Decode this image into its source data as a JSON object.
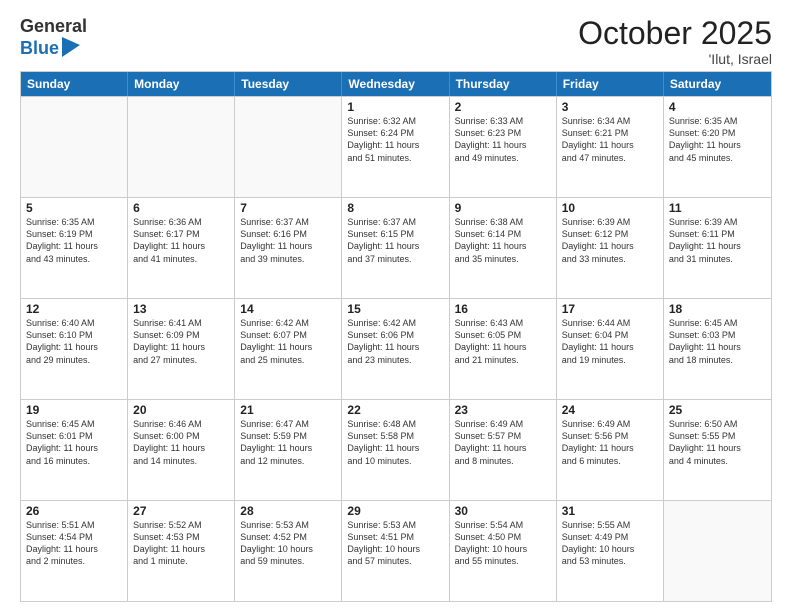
{
  "logo": {
    "general": "General",
    "blue": "Blue"
  },
  "title": "October 2025",
  "subtitle": "'Ilut, Israel",
  "days": [
    "Sunday",
    "Monday",
    "Tuesday",
    "Wednesday",
    "Thursday",
    "Friday",
    "Saturday"
  ],
  "weeks": [
    [
      {
        "day": "",
        "text": ""
      },
      {
        "day": "",
        "text": ""
      },
      {
        "day": "",
        "text": ""
      },
      {
        "day": "1",
        "text": "Sunrise: 6:32 AM\nSunset: 6:24 PM\nDaylight: 11 hours\nand 51 minutes."
      },
      {
        "day": "2",
        "text": "Sunrise: 6:33 AM\nSunset: 6:23 PM\nDaylight: 11 hours\nand 49 minutes."
      },
      {
        "day": "3",
        "text": "Sunrise: 6:34 AM\nSunset: 6:21 PM\nDaylight: 11 hours\nand 47 minutes."
      },
      {
        "day": "4",
        "text": "Sunrise: 6:35 AM\nSunset: 6:20 PM\nDaylight: 11 hours\nand 45 minutes."
      }
    ],
    [
      {
        "day": "5",
        "text": "Sunrise: 6:35 AM\nSunset: 6:19 PM\nDaylight: 11 hours\nand 43 minutes."
      },
      {
        "day": "6",
        "text": "Sunrise: 6:36 AM\nSunset: 6:17 PM\nDaylight: 11 hours\nand 41 minutes."
      },
      {
        "day": "7",
        "text": "Sunrise: 6:37 AM\nSunset: 6:16 PM\nDaylight: 11 hours\nand 39 minutes."
      },
      {
        "day": "8",
        "text": "Sunrise: 6:37 AM\nSunset: 6:15 PM\nDaylight: 11 hours\nand 37 minutes."
      },
      {
        "day": "9",
        "text": "Sunrise: 6:38 AM\nSunset: 6:14 PM\nDaylight: 11 hours\nand 35 minutes."
      },
      {
        "day": "10",
        "text": "Sunrise: 6:39 AM\nSunset: 6:12 PM\nDaylight: 11 hours\nand 33 minutes."
      },
      {
        "day": "11",
        "text": "Sunrise: 6:39 AM\nSunset: 6:11 PM\nDaylight: 11 hours\nand 31 minutes."
      }
    ],
    [
      {
        "day": "12",
        "text": "Sunrise: 6:40 AM\nSunset: 6:10 PM\nDaylight: 11 hours\nand 29 minutes."
      },
      {
        "day": "13",
        "text": "Sunrise: 6:41 AM\nSunset: 6:09 PM\nDaylight: 11 hours\nand 27 minutes."
      },
      {
        "day": "14",
        "text": "Sunrise: 6:42 AM\nSunset: 6:07 PM\nDaylight: 11 hours\nand 25 minutes."
      },
      {
        "day": "15",
        "text": "Sunrise: 6:42 AM\nSunset: 6:06 PM\nDaylight: 11 hours\nand 23 minutes."
      },
      {
        "day": "16",
        "text": "Sunrise: 6:43 AM\nSunset: 6:05 PM\nDaylight: 11 hours\nand 21 minutes."
      },
      {
        "day": "17",
        "text": "Sunrise: 6:44 AM\nSunset: 6:04 PM\nDaylight: 11 hours\nand 19 minutes."
      },
      {
        "day": "18",
        "text": "Sunrise: 6:45 AM\nSunset: 6:03 PM\nDaylight: 11 hours\nand 18 minutes."
      }
    ],
    [
      {
        "day": "19",
        "text": "Sunrise: 6:45 AM\nSunset: 6:01 PM\nDaylight: 11 hours\nand 16 minutes."
      },
      {
        "day": "20",
        "text": "Sunrise: 6:46 AM\nSunset: 6:00 PM\nDaylight: 11 hours\nand 14 minutes."
      },
      {
        "day": "21",
        "text": "Sunrise: 6:47 AM\nSunset: 5:59 PM\nDaylight: 11 hours\nand 12 minutes."
      },
      {
        "day": "22",
        "text": "Sunrise: 6:48 AM\nSunset: 5:58 PM\nDaylight: 11 hours\nand 10 minutes."
      },
      {
        "day": "23",
        "text": "Sunrise: 6:49 AM\nSunset: 5:57 PM\nDaylight: 11 hours\nand 8 minutes."
      },
      {
        "day": "24",
        "text": "Sunrise: 6:49 AM\nSunset: 5:56 PM\nDaylight: 11 hours\nand 6 minutes."
      },
      {
        "day": "25",
        "text": "Sunrise: 6:50 AM\nSunset: 5:55 PM\nDaylight: 11 hours\nand 4 minutes."
      }
    ],
    [
      {
        "day": "26",
        "text": "Sunrise: 5:51 AM\nSunset: 4:54 PM\nDaylight: 11 hours\nand 2 minutes."
      },
      {
        "day": "27",
        "text": "Sunrise: 5:52 AM\nSunset: 4:53 PM\nDaylight: 11 hours\nand 1 minute."
      },
      {
        "day": "28",
        "text": "Sunrise: 5:53 AM\nSunset: 4:52 PM\nDaylight: 10 hours\nand 59 minutes."
      },
      {
        "day": "29",
        "text": "Sunrise: 5:53 AM\nSunset: 4:51 PM\nDaylight: 10 hours\nand 57 minutes."
      },
      {
        "day": "30",
        "text": "Sunrise: 5:54 AM\nSunset: 4:50 PM\nDaylight: 10 hours\nand 55 minutes."
      },
      {
        "day": "31",
        "text": "Sunrise: 5:55 AM\nSunset: 4:49 PM\nDaylight: 10 hours\nand 53 minutes."
      },
      {
        "day": "",
        "text": ""
      }
    ]
  ]
}
